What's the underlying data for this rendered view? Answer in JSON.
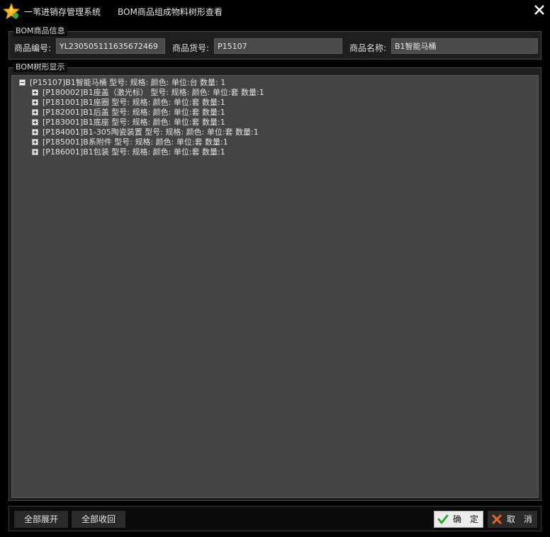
{
  "window": {
    "app_name": "一苇进销存管理系统",
    "title": "BOM商品组成物料树形查看"
  },
  "info_group": {
    "legend": "BOM商品信息",
    "code_label": "商品编号:",
    "code_value": "YL230505111635672469",
    "sku_label": "商品货号:",
    "sku_value": "P15107",
    "name_label": "商品名称:",
    "name_value": "B1智能马桶"
  },
  "tree_group": {
    "legend": "BOM树形显示",
    "root": {
      "text": "[P15107]B1智能马桶 型号: 规格: 颜色: 单位:台 数量: 1",
      "expanded": true
    },
    "children": [
      {
        "text": "[P180002]B1座盖（激光标） 型号: 规格: 颜色: 单位:套 数量:1"
      },
      {
        "text": "[P181001]B1座圈 型号: 规格: 颜色: 单位:套 数量:1"
      },
      {
        "text": "[P182001]B1后盖 型号: 规格: 颜色: 单位:套 数量:1"
      },
      {
        "text": "[P183001]B1底座 型号: 规格: 颜色: 单位:套 数量:1"
      },
      {
        "text": "[P184001]B1-305陶瓷装置 型号: 规格: 颜色: 单位:套 数量:1"
      },
      {
        "text": "[P185001]B系附件 型号: 规格: 颜色: 单位:套 数量:1"
      },
      {
        "text": "[P186001]B1包装 型号: 规格: 颜色: 单位:套 数量:1"
      }
    ]
  },
  "buttons": {
    "expand_all": "全部展开",
    "collapse_all": "全部收回",
    "ok": "确 定",
    "cancel": "取 消"
  },
  "icons": {
    "app": "star-icon",
    "close": "close-icon",
    "ok": "checkmark-icon",
    "cancel": "cross-icon"
  },
  "colors": {
    "background": "#000000",
    "panel": "#444444",
    "input": "#4a4a4a",
    "ok_check": "#2fa82f",
    "cancel_x": "#e8642a",
    "star": "#f2b51e"
  }
}
